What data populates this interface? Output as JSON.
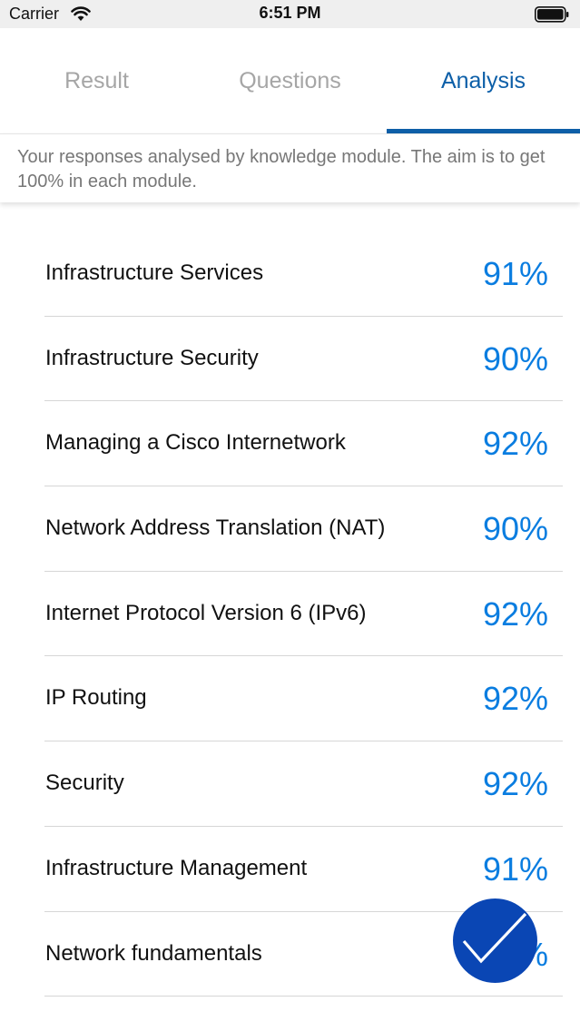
{
  "status_bar": {
    "carrier": "Carrier",
    "time": "6:51 PM",
    "wifi_icon": "wifi-icon",
    "battery_icon": "battery-icon"
  },
  "tabs": [
    {
      "label": "Result",
      "active": false
    },
    {
      "label": "Questions",
      "active": false
    },
    {
      "label": "Analysis",
      "active": true
    }
  ],
  "info_banner": {
    "text": "Your responses analysed by knowledge module. The aim is to get 100% in each module."
  },
  "modules": [
    {
      "name": "Infrastructure Services",
      "score": "91%"
    },
    {
      "name": "Infrastructure Security",
      "score": "90%"
    },
    {
      "name": "Managing a Cisco Internetwork",
      "score": "92%"
    },
    {
      "name": "Network Address Translation (NAT)",
      "score": "90%"
    },
    {
      "name": "Internet Protocol Version 6 (IPv6)",
      "score": "92%"
    },
    {
      "name": "IP Routing",
      "score": "92%"
    },
    {
      "name": "Security",
      "score": "92%"
    },
    {
      "name": "Infrastructure Management",
      "score": "91%"
    },
    {
      "name": "Network fundamentals",
      "score": "%"
    }
  ],
  "fab": {
    "icon": "checkmark-icon"
  },
  "colors": {
    "accent": "#0d5fa8",
    "score": "#0a7de0",
    "fab": "#0a46b4",
    "inactive_tab": "#a6a6a6"
  }
}
